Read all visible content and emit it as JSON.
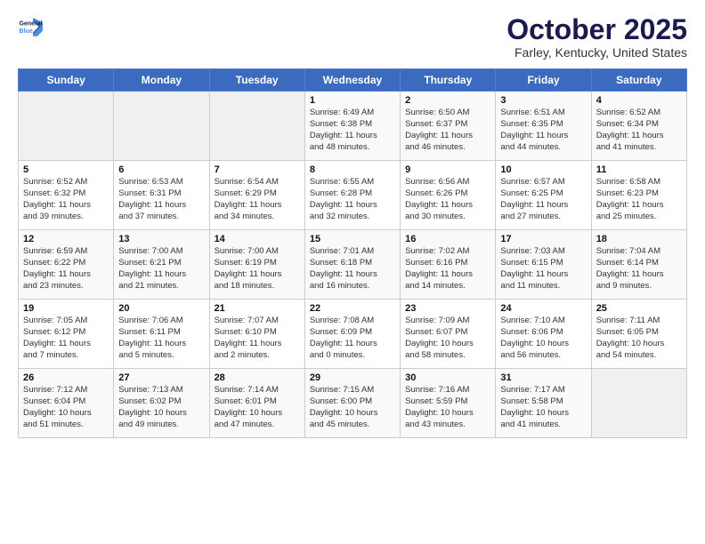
{
  "header": {
    "logo_line1": "General",
    "logo_line2": "Blue",
    "month": "October 2025",
    "location": "Farley, Kentucky, United States"
  },
  "weekdays": [
    "Sunday",
    "Monday",
    "Tuesday",
    "Wednesday",
    "Thursday",
    "Friday",
    "Saturday"
  ],
  "weeks": [
    [
      {
        "day": "",
        "info": ""
      },
      {
        "day": "",
        "info": ""
      },
      {
        "day": "",
        "info": ""
      },
      {
        "day": "1",
        "info": "Sunrise: 6:49 AM\nSunset: 6:38 PM\nDaylight: 11 hours\nand 48 minutes."
      },
      {
        "day": "2",
        "info": "Sunrise: 6:50 AM\nSunset: 6:37 PM\nDaylight: 11 hours\nand 46 minutes."
      },
      {
        "day": "3",
        "info": "Sunrise: 6:51 AM\nSunset: 6:35 PM\nDaylight: 11 hours\nand 44 minutes."
      },
      {
        "day": "4",
        "info": "Sunrise: 6:52 AM\nSunset: 6:34 PM\nDaylight: 11 hours\nand 41 minutes."
      }
    ],
    [
      {
        "day": "5",
        "info": "Sunrise: 6:52 AM\nSunset: 6:32 PM\nDaylight: 11 hours\nand 39 minutes."
      },
      {
        "day": "6",
        "info": "Sunrise: 6:53 AM\nSunset: 6:31 PM\nDaylight: 11 hours\nand 37 minutes."
      },
      {
        "day": "7",
        "info": "Sunrise: 6:54 AM\nSunset: 6:29 PM\nDaylight: 11 hours\nand 34 minutes."
      },
      {
        "day": "8",
        "info": "Sunrise: 6:55 AM\nSunset: 6:28 PM\nDaylight: 11 hours\nand 32 minutes."
      },
      {
        "day": "9",
        "info": "Sunrise: 6:56 AM\nSunset: 6:26 PM\nDaylight: 11 hours\nand 30 minutes."
      },
      {
        "day": "10",
        "info": "Sunrise: 6:57 AM\nSunset: 6:25 PM\nDaylight: 11 hours\nand 27 minutes."
      },
      {
        "day": "11",
        "info": "Sunrise: 6:58 AM\nSunset: 6:23 PM\nDaylight: 11 hours\nand 25 minutes."
      }
    ],
    [
      {
        "day": "12",
        "info": "Sunrise: 6:59 AM\nSunset: 6:22 PM\nDaylight: 11 hours\nand 23 minutes."
      },
      {
        "day": "13",
        "info": "Sunrise: 7:00 AM\nSunset: 6:21 PM\nDaylight: 11 hours\nand 21 minutes."
      },
      {
        "day": "14",
        "info": "Sunrise: 7:00 AM\nSunset: 6:19 PM\nDaylight: 11 hours\nand 18 minutes."
      },
      {
        "day": "15",
        "info": "Sunrise: 7:01 AM\nSunset: 6:18 PM\nDaylight: 11 hours\nand 16 minutes."
      },
      {
        "day": "16",
        "info": "Sunrise: 7:02 AM\nSunset: 6:16 PM\nDaylight: 11 hours\nand 14 minutes."
      },
      {
        "day": "17",
        "info": "Sunrise: 7:03 AM\nSunset: 6:15 PM\nDaylight: 11 hours\nand 11 minutes."
      },
      {
        "day": "18",
        "info": "Sunrise: 7:04 AM\nSunset: 6:14 PM\nDaylight: 11 hours\nand 9 minutes."
      }
    ],
    [
      {
        "day": "19",
        "info": "Sunrise: 7:05 AM\nSunset: 6:12 PM\nDaylight: 11 hours\nand 7 minutes."
      },
      {
        "day": "20",
        "info": "Sunrise: 7:06 AM\nSunset: 6:11 PM\nDaylight: 11 hours\nand 5 minutes."
      },
      {
        "day": "21",
        "info": "Sunrise: 7:07 AM\nSunset: 6:10 PM\nDaylight: 11 hours\nand 2 minutes."
      },
      {
        "day": "22",
        "info": "Sunrise: 7:08 AM\nSunset: 6:09 PM\nDaylight: 11 hours\nand 0 minutes."
      },
      {
        "day": "23",
        "info": "Sunrise: 7:09 AM\nSunset: 6:07 PM\nDaylight: 10 hours\nand 58 minutes."
      },
      {
        "day": "24",
        "info": "Sunrise: 7:10 AM\nSunset: 6:06 PM\nDaylight: 10 hours\nand 56 minutes."
      },
      {
        "day": "25",
        "info": "Sunrise: 7:11 AM\nSunset: 6:05 PM\nDaylight: 10 hours\nand 54 minutes."
      }
    ],
    [
      {
        "day": "26",
        "info": "Sunrise: 7:12 AM\nSunset: 6:04 PM\nDaylight: 10 hours\nand 51 minutes."
      },
      {
        "day": "27",
        "info": "Sunrise: 7:13 AM\nSunset: 6:02 PM\nDaylight: 10 hours\nand 49 minutes."
      },
      {
        "day": "28",
        "info": "Sunrise: 7:14 AM\nSunset: 6:01 PM\nDaylight: 10 hours\nand 47 minutes."
      },
      {
        "day": "29",
        "info": "Sunrise: 7:15 AM\nSunset: 6:00 PM\nDaylight: 10 hours\nand 45 minutes."
      },
      {
        "day": "30",
        "info": "Sunrise: 7:16 AM\nSunset: 5:59 PM\nDaylight: 10 hours\nand 43 minutes."
      },
      {
        "day": "31",
        "info": "Sunrise: 7:17 AM\nSunset: 5:58 PM\nDaylight: 10 hours\nand 41 minutes."
      },
      {
        "day": "",
        "info": ""
      }
    ]
  ]
}
